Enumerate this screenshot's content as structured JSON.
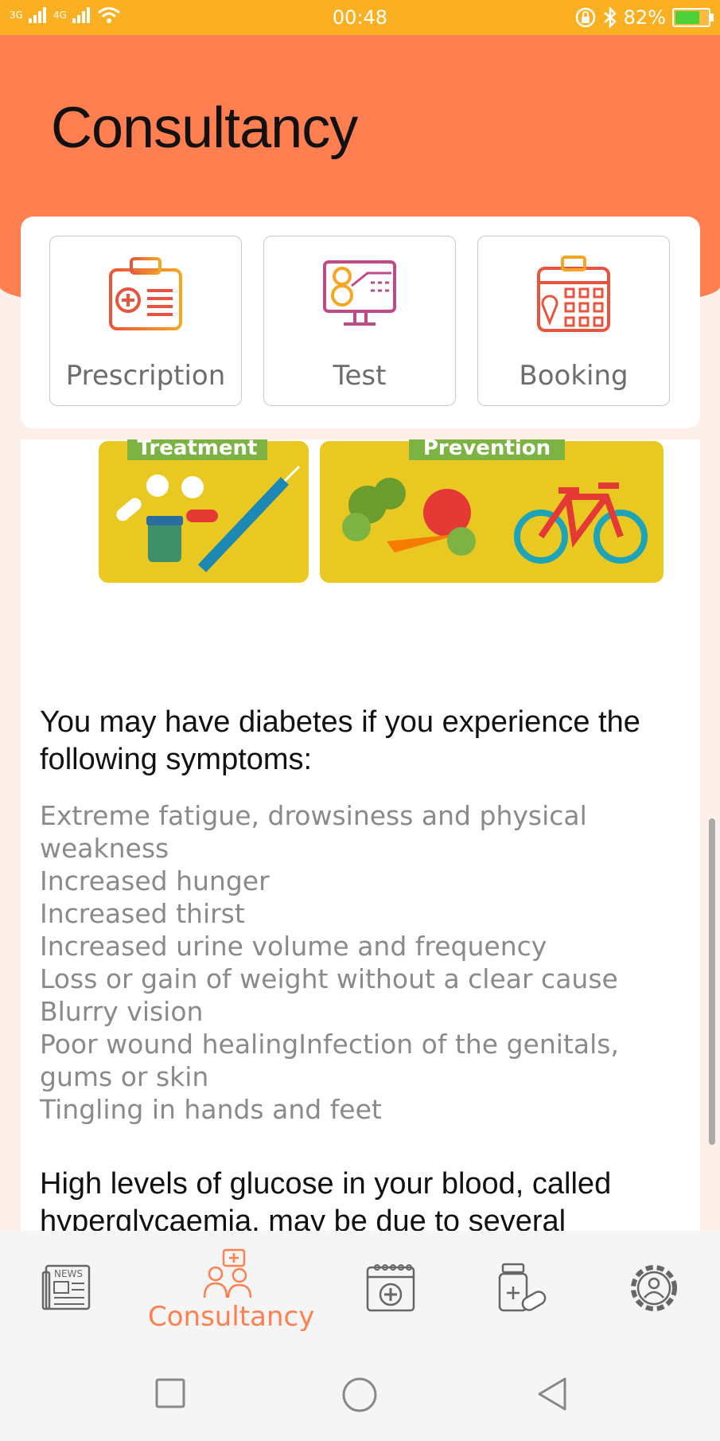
{
  "status_bar": {
    "network_1": "3G",
    "network_2": "4G",
    "time": "00:48",
    "battery_percent": "82%",
    "battery_level": 0.82
  },
  "header": {
    "title": "Consultancy"
  },
  "actions": [
    {
      "label": "Prescription",
      "icon": "prescription-icon"
    },
    {
      "label": "Test",
      "icon": "test-icon"
    },
    {
      "label": "Booking",
      "icon": "booking-icon"
    }
  ],
  "illustration": {
    "left_tag": "Treatment",
    "right_tag": "Prevention"
  },
  "content": {
    "symptoms_heading": "You may have diabetes if you experience the following symptoms:",
    "symptoms": [
      "Extreme fatigue, drowsiness and physical weakness",
      "Increased hunger",
      "Increased thirst",
      "Increased urine volume and frequency",
      "Loss or gain of weight without a clear cause",
      "Blurry vision",
      "Poor wound healingInfection of the genitals, gums or skin",
      "Tingling in hands and feet"
    ],
    "next_heading": "High levels of glucose in your blood, called hyperglycaemia, may be due to several"
  },
  "bottom_nav": {
    "items": [
      {
        "icon": "news-icon",
        "label": ""
      },
      {
        "icon": "consultancy-icon",
        "label": "Consultancy",
        "active": true
      },
      {
        "icon": "calendar-medical-icon",
        "label": ""
      },
      {
        "icon": "medicine-icon",
        "label": ""
      },
      {
        "icon": "settings-icon",
        "label": ""
      }
    ],
    "news_text": "NEWS"
  },
  "colors": {
    "status_bar": "#fbb021",
    "header": "#ff7f50",
    "accent": "#ff7f50",
    "tile_yellow": "#e9c821",
    "tag_green": "#7cb342"
  }
}
